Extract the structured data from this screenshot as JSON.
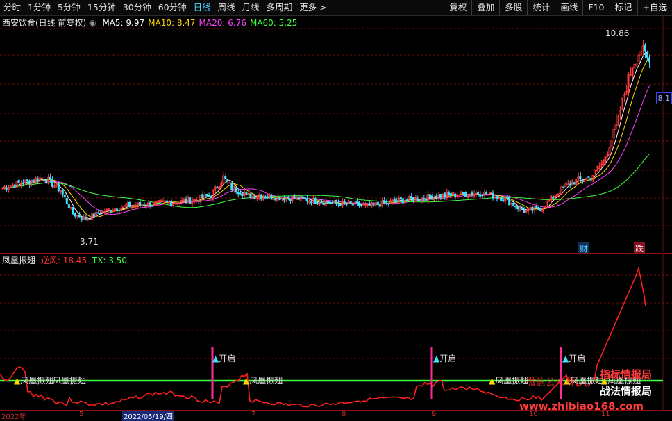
{
  "toolbar": {
    "periods": [
      "分时",
      "1分钟",
      "5分钟",
      "15分钟",
      "30分钟",
      "60分钟",
      "日线",
      "周线",
      "月线",
      "多周期",
      "更多 >"
    ],
    "active_period": "日线",
    "actions": [
      "复权",
      "叠加",
      "多股",
      "统计",
      "画线",
      "F10",
      "标记",
      "+自选"
    ]
  },
  "main_chart": {
    "title": "西安饮食(日线 前复权)",
    "ma": [
      {
        "label": "MA5:",
        "value": "9.97",
        "color": "#ffffff"
      },
      {
        "label": "MA10:",
        "value": "8.47",
        "color": "#ffd700"
      },
      {
        "label": "MA20:",
        "value": "6.76",
        "color": "#ff40ff"
      },
      {
        "label": "MA60:",
        "value": "5.25",
        "color": "#40ff40"
      }
    ],
    "high_label": "10.86",
    "low_label": "3.71",
    "price_tag": "8.1",
    "marker_cai": "财",
    "marker_die": "跌"
  },
  "indicator": {
    "name": "凤凰振翅",
    "nifeng_label": "逆风:",
    "nifeng_value": "18.45",
    "tx_label": "TX:",
    "tx_value": "3.50",
    "signal_open": "开启",
    "signal_fh": "凤凰振翅"
  },
  "x_axis": {
    "labels": [
      "2022年",
      "5",
      "2022/05/19/四",
      "7",
      "8",
      "9",
      "10",
      "11"
    ]
  },
  "watermark": {
    "line1": "指标情报局",
    "line2": "战法情报局",
    "wechat": "微信公众号",
    "site": "www.zhibiao168.com"
  },
  "chart_data": {
    "type": "candlestick",
    "y_range": [
      3.0,
      11.5
    ],
    "notable": {
      "high": 10.86,
      "low": 3.71
    },
    "ma_latest": {
      "MA5": 9.97,
      "MA10": 8.47,
      "MA20": 6.76,
      "MA60": 5.25
    },
    "indicator_latest": {
      "逆风": 18.45,
      "TX": 3.5
    }
  }
}
